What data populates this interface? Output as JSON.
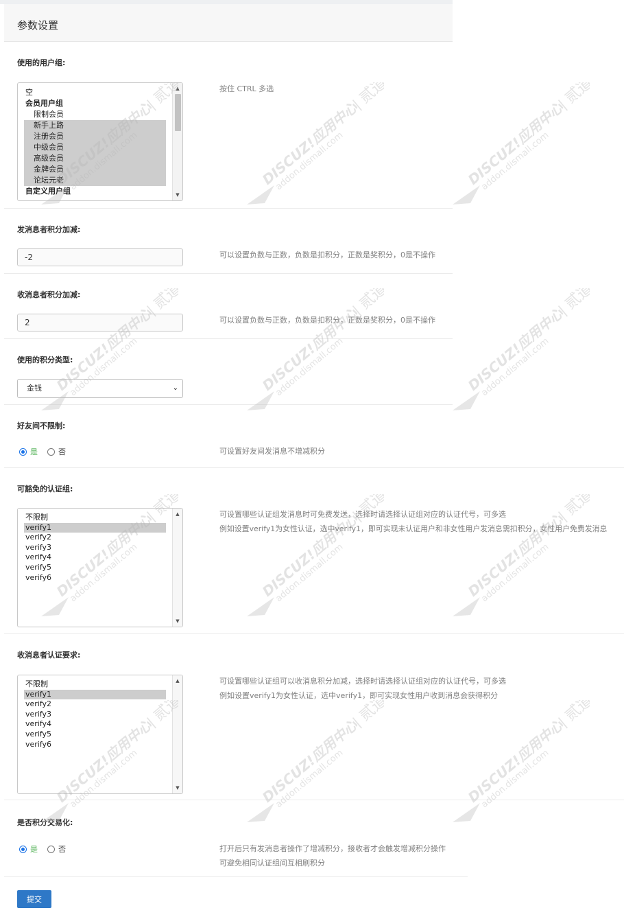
{
  "header": {
    "title": "参数设置"
  },
  "usergroups": {
    "label": "使用的用户组:",
    "help": "按住 CTRL 多选",
    "options": [
      {
        "text": "空",
        "kind": "plain",
        "selected": false
      },
      {
        "text": "会员用户组",
        "kind": "group",
        "selected": false
      },
      {
        "text": "限制会员",
        "kind": "child",
        "selected": false
      },
      {
        "text": "新手上路",
        "kind": "child",
        "selected": true
      },
      {
        "text": "注册会员",
        "kind": "child",
        "selected": true
      },
      {
        "text": "中级会员",
        "kind": "child",
        "selected": true
      },
      {
        "text": "高级会员",
        "kind": "child",
        "selected": true
      },
      {
        "text": "金牌会员",
        "kind": "child",
        "selected": true
      },
      {
        "text": "论坛元老",
        "kind": "child",
        "selected": true
      },
      {
        "text": "自定义用户组",
        "kind": "group",
        "selected": false
      }
    ]
  },
  "sender_points": {
    "label": "发消息者积分加减:",
    "value": "-2",
    "help": "可以设置负数与正数，负数是扣积分，正数是奖积分，0是不操作"
  },
  "receiver_points": {
    "label": "收消息者积分加减:",
    "value": "2",
    "help": "可以设置负数与正数，负数是扣积分，正数是奖积分，0是不操作"
  },
  "points_type": {
    "label": "使用的积分类型:",
    "selected": "金钱"
  },
  "friends_unlimited": {
    "label": "好友间不限制:",
    "yes": "是",
    "no": "否",
    "value": "yes",
    "help": "可设置好友间发消息不增减积分"
  },
  "exempt_verify": {
    "label": "可豁免的认证组:",
    "help1": "可设置哪些认证组发消息时可免费发送，选择时请选择认证组对应的认证代号，可多选",
    "help2": "例如设置verify1为女性认证，选中verify1，即可实现未认证用户和非女性用户发消息需扣积分，女性用户免费发消息",
    "options": [
      {
        "text": "不限制",
        "selected": false
      },
      {
        "text": "verify1",
        "selected": true
      },
      {
        "text": "verify2",
        "selected": false
      },
      {
        "text": "verify3",
        "selected": false
      },
      {
        "text": "verify4",
        "selected": false
      },
      {
        "text": "verify5",
        "selected": false
      },
      {
        "text": "verify6",
        "selected": false
      }
    ]
  },
  "receiver_verify": {
    "label": "收消息者认证要求:",
    "help1": "可设置哪些认证组可以收消息积分加减，选择时请选择认证组对应的认证代号，可多选",
    "help2": "例如设置verify1为女性认证，选中verify1，即可实现女性用户收到消息会获得积分",
    "options": [
      {
        "text": "不限制",
        "selected": false
      },
      {
        "text": "verify1",
        "selected": true
      },
      {
        "text": "verify2",
        "selected": false
      },
      {
        "text": "verify3",
        "selected": false
      },
      {
        "text": "verify4",
        "selected": false
      },
      {
        "text": "verify5",
        "selected": false
      },
      {
        "text": "verify6",
        "selected": false
      }
    ]
  },
  "trade_mode": {
    "label": "是否积分交易化:",
    "yes": "是",
    "no": "否",
    "value": "yes",
    "help1": "打开后只有发消息者操作了增减积分，接收者才会触发增减积分操作",
    "help2": "可避免相同认证组间互相刷积分"
  },
  "submit_label": "提交",
  "watermark": {
    "brand": "DISCUZ!应用中心",
    "sep": "|",
    "cn": "贰道",
    "domain": "addon.dismall.com",
    "reg": "®"
  }
}
